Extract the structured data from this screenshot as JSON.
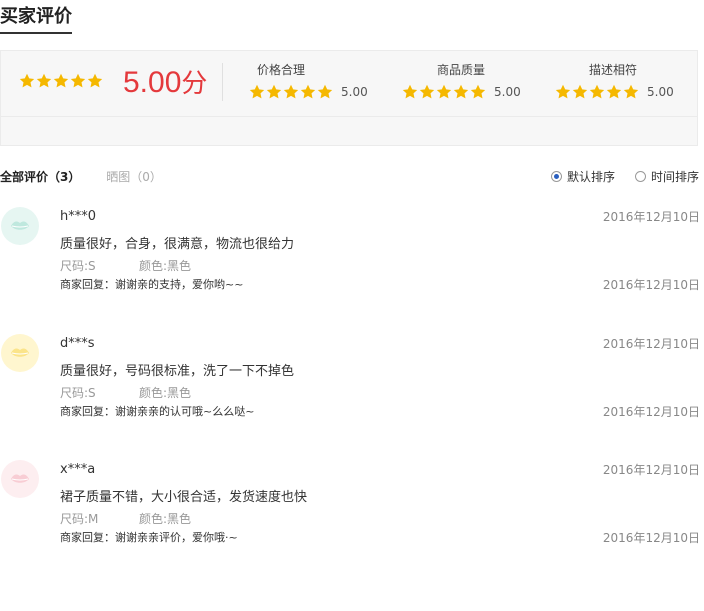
{
  "title": "买家评价",
  "summary": {
    "overall_score": "5.00",
    "overall_unit": "分",
    "overall_stars": 5,
    "dimensions": [
      {
        "label": "价格合理",
        "score": "5.00",
        "stars": 5
      },
      {
        "label": "商品质量",
        "score": "5.00",
        "stars": 5
      },
      {
        "label": "描述相符",
        "score": "5.00",
        "stars": 5
      }
    ]
  },
  "tabs": {
    "all_label": "全部评价",
    "all_count": "3",
    "image_label": "晒图",
    "image_count": "0"
  },
  "sort": {
    "default_label": "默认排序",
    "time_label": "时间排序",
    "selected": "default"
  },
  "colors": {
    "star": "#f5b800",
    "score": "#e4393c"
  },
  "reviews": [
    {
      "user": "h***0",
      "date": "2016年12月10日",
      "text": "质量很好，合身，很满意，物流也很给力",
      "size_label": "尺码:S",
      "color_label": "颜色:黑色",
      "reply": "商家回复：谢谢亲的支持，爱你哟~~",
      "reply_date": "2016年12月10日",
      "avatar_icon": "lips-icon",
      "avatar_bg": "#e6f6f2",
      "avatar_fg": "#bfe8de"
    },
    {
      "user": "d***s",
      "date": "2016年12月10日",
      "text": "质量很好，号码很标准，洗了一下不掉色",
      "size_label": "尺码:S",
      "color_label": "颜色:黑色",
      "reply": "商家回复：谢谢亲亲的认可哦~么么哒~",
      "reply_date": "2016年12月10日",
      "avatar_icon": "lips-icon",
      "avatar_bg": "#fff6cf",
      "avatar_fg": "#fbe48a"
    },
    {
      "user": "x***a",
      "date": "2016年12月10日",
      "text": "裙子质量不错，大小很合适，发货速度也快",
      "size_label": "尺码:M",
      "color_label": "颜色:黑色",
      "reply": "商家回复：谢谢亲亲评价，爱你哦·~",
      "reply_date": "2016年12月10日",
      "avatar_icon": "lips-icon",
      "avatar_bg": "#fdeef0",
      "avatar_fg": "#f8cdd4"
    }
  ]
}
